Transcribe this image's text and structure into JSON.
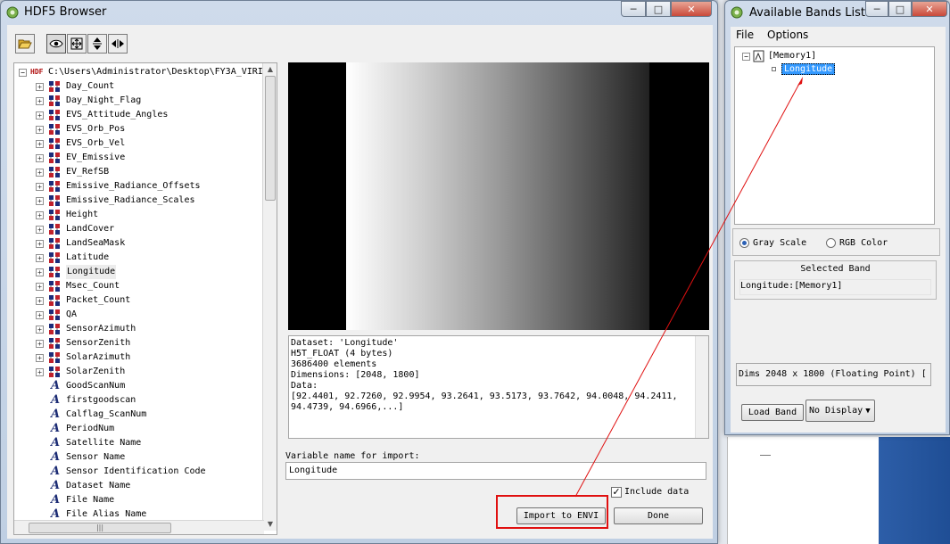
{
  "hdf5_browser": {
    "title": "HDF5 Browser",
    "toolbar": {
      "open_icon": "folder-open-icon",
      "view_icon": "eye-icon",
      "fit_icon": "fit-view-icon",
      "zoom_vertical_icon": "vertical-arrows-icon",
      "zoom_horizontal_icon": "horizontal-arrows-icon"
    },
    "tree": {
      "root_path": "C:\\Users\\Administrator\\Desktop\\FY3A_VIRI",
      "datasets": [
        "Day_Count",
        "Day_Night_Flag",
        "EVS_Attitude_Angles",
        "EVS_Orb_Pos",
        "EVS_Orb_Vel",
        "EV_Emissive",
        "EV_RefSB",
        "Emissive_Radiance_Offsets",
        "Emissive_Radiance_Scales",
        "Height",
        "LandCover",
        "LandSeaMask",
        "Latitude",
        "Longitude",
        "Msec_Count",
        "Packet_Count",
        "QA",
        "SensorAzimuth",
        "SensorZenith",
        "SolarAzimuth",
        "SolarZenith"
      ],
      "attributes": [
        "GoodScanNum",
        "firstgoodscan",
        "Calflag_ScanNum",
        "PeriodNum",
        "Satellite Name",
        "Sensor Name",
        "Sensor Identification Code",
        "Dataset Name",
        "File Name",
        "File Alias Name"
      ],
      "selected": "Longitude"
    },
    "info": {
      "lines": [
        "Dataset: 'Longitude'",
        "H5T_FLOAT (4 bytes)",
        "3686400 elements",
        "Dimensions: [2048, 1800]",
        "Data:",
        "[92.4401, 92.7260, 92.9954, 93.2641, 93.5173, 93.7642, 94.0048, 94.2411,",
        "94.4739, 94.6966,...]"
      ]
    },
    "variable_label": "Variable name for import:",
    "variable_value": "Longitude",
    "include_data_label": "Include data",
    "include_data_checked": true,
    "import_button": "Import to ENVI",
    "done_button": "Done"
  },
  "bands_list": {
    "title": "Available Bands List",
    "menu": [
      "File",
      "Options"
    ],
    "tree_root": "[Memory1]",
    "tree_child": "Longitude",
    "gray_scale": "Gray Scale",
    "rgb_color": "RGB Color",
    "selected_band_header": "Selected Band",
    "selected_band_value": "Longitude:[Memory1]",
    "dims": "Dims 2048 x 1800 (Floating Point) [",
    "load_band": "Load Band",
    "display_option": "No Display"
  }
}
